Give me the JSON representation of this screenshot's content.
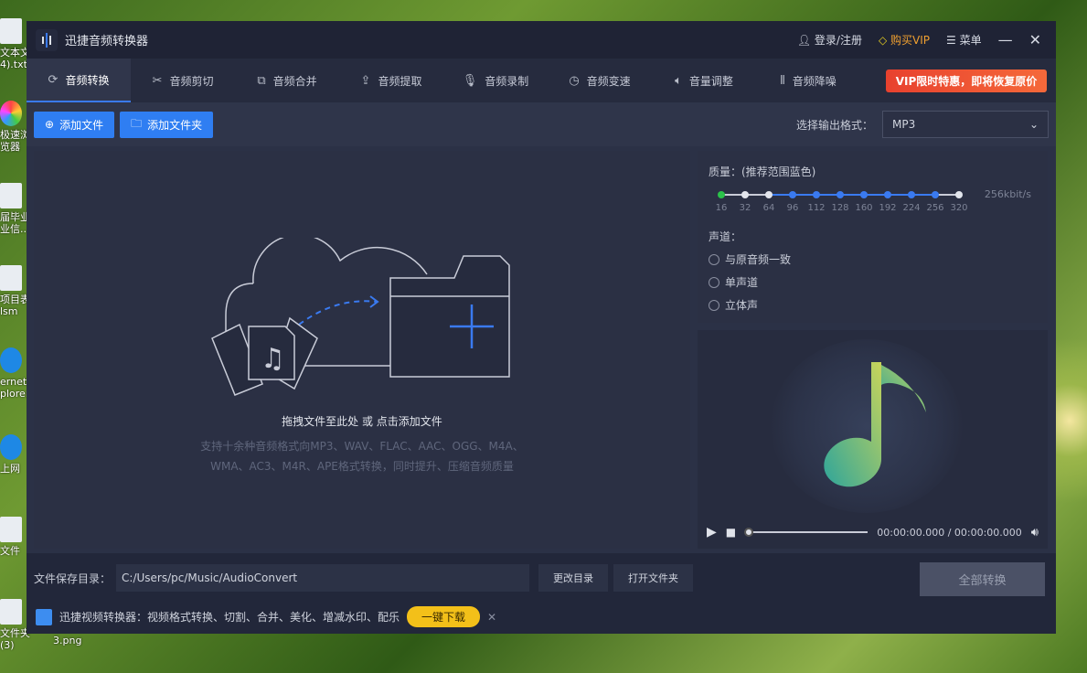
{
  "desktop": {
    "icons": [
      "文本文",
      "4).txt",
      "极速浏",
      "览器",
      "届毕业",
      "业信..",
      "项目表",
      "lsm",
      "ernet",
      "plorer",
      "上网",
      "文件",
      "文件夹",
      "(3)",
      "3.png"
    ]
  },
  "window": {
    "title": "迅捷音频转换器",
    "login": "登录/注册",
    "buy_vip": "购买VIP",
    "menu": "菜单"
  },
  "tabs": [
    {
      "label": "音频转换",
      "icon": "refresh-icon"
    },
    {
      "label": "音频剪切",
      "icon": "scissors-icon"
    },
    {
      "label": "音频合并",
      "icon": "merge-icon"
    },
    {
      "label": "音频提取",
      "icon": "upload-icon"
    },
    {
      "label": "音频录制",
      "icon": "microphone-icon"
    },
    {
      "label": "音频变速",
      "icon": "speed-icon"
    },
    {
      "label": "音量调整",
      "icon": "volume-icon"
    },
    {
      "label": "音频降噪",
      "icon": "noise-icon"
    }
  ],
  "vip_banner": "VIP限时特惠，即将恢复原价",
  "toolbar": {
    "add_file": "添加文件",
    "add_folder": "添加文件夹",
    "format_label": "选择输出格式：",
    "format_value": "MP3"
  },
  "drop": {
    "hint": "拖拽文件至此处 或 点击添加文件",
    "desc1": "支持十余种音频格式向MP3、WAV、FLAC、AAC、OGG、M4A、",
    "desc2": "WMA、AC3、M4R、APE格式转换，同时提升、压缩音频质量"
  },
  "settings": {
    "quality_label": "质量：(推荐范围蓝色)",
    "bitrates": [
      "16",
      "32",
      "64",
      "96",
      "112",
      "128",
      "160",
      "192",
      "224",
      "256",
      "320"
    ],
    "selected": "256kbit/s",
    "channel_label": "声道：",
    "channels": [
      "与原音频一致",
      "单声道",
      "立体声"
    ]
  },
  "player": {
    "time": "00:00:00.000 / 00:00:00.000",
    "progress": 0
  },
  "bottom": {
    "save_label": "文件保存目录：",
    "save_path": "C:/Users/pc/Music/AudioConvert",
    "change_dir": "更改目录",
    "open_folder": "打开文件夹",
    "convert_all": "全部转换",
    "ad_text": "迅捷视频转换器：视频格式转换、切割、合并、美化、增减水印、配乐",
    "ad_download": "一键下载",
    "ad_close": "✕"
  },
  "colors": {
    "accent": "#2f7ef2",
    "vip": "#f0a030",
    "banner": "#e8412e"
  }
}
